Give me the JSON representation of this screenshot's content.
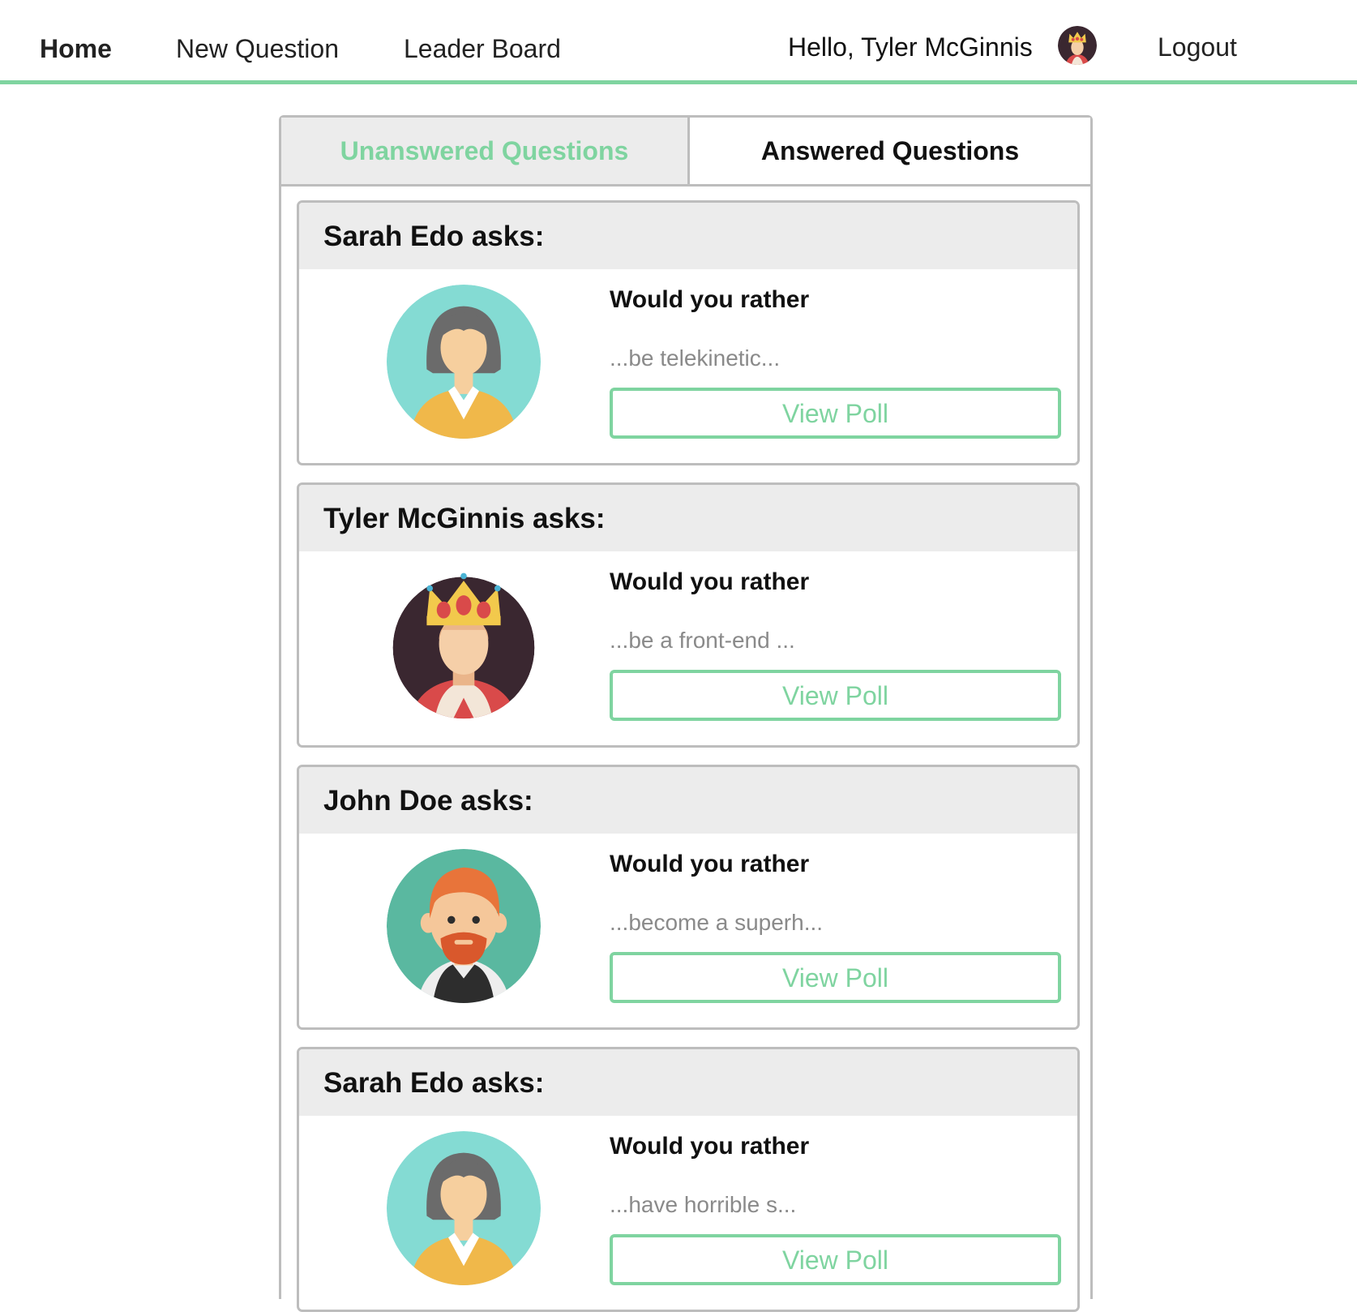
{
  "nav": {
    "home": "Home",
    "new_question": "New Question",
    "leader_board": "Leader Board",
    "greeting": "Hello, Tyler McGinnis",
    "logout": "Logout"
  },
  "tabs": {
    "unanswered": "Unanswered Questions",
    "answered": "Answered Questions"
  },
  "questions": [
    {
      "author_label": "Sarah Edo asks:",
      "avatar": "sarah-avatar-icon",
      "prompt": "Would you rather",
      "snippet": "...be telekinetic...",
      "button": "View Poll"
    },
    {
      "author_label": "Tyler McGinnis asks:",
      "avatar": "tyler-avatar-icon",
      "prompt": "Would you rather",
      "snippet": "...be a front-end ...",
      "button": "View Poll"
    },
    {
      "author_label": "John Doe asks:",
      "avatar": "john-avatar-icon",
      "prompt": "Would you rather",
      "snippet": "...become a superh...",
      "button": "View Poll"
    },
    {
      "author_label": "Sarah Edo asks:",
      "avatar": "sarah-avatar-icon",
      "prompt": "Would you rather",
      "snippet": "...have horrible s...",
      "button": "View Poll"
    }
  ],
  "colors": {
    "accent": "#7fd4a0",
    "border": "#bdbdbd",
    "header_bg": "#ececec",
    "muted_text": "#8a8a8a"
  }
}
